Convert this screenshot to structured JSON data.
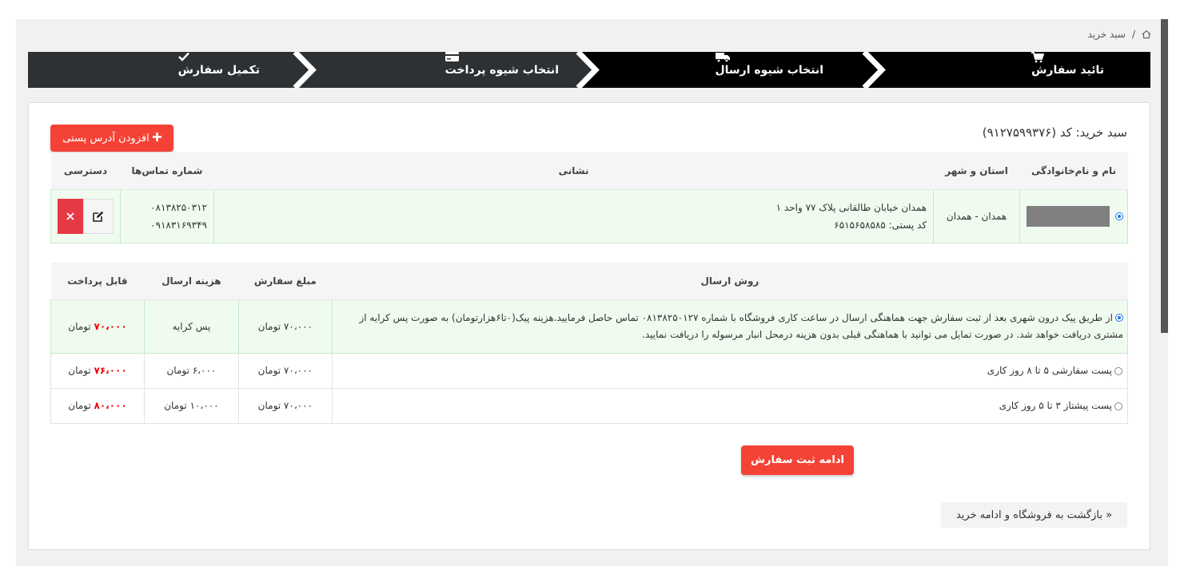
{
  "breadcrumb": {
    "home_icon": "home-icon",
    "separator": "/",
    "current": "سبد خرید"
  },
  "steps": [
    {
      "label": "تائید سفارش",
      "icon": "cart-icon"
    },
    {
      "label": "انتخاب شیوه ارسال",
      "icon": "truck-icon"
    },
    {
      "label": "انتخاب شیوه پرداخت",
      "icon": "credit-card-icon"
    },
    {
      "label": "تکمیل سفارش",
      "icon": "check-icon"
    }
  ],
  "cart": {
    "title": "سبد خرید: کد (۹۱۲۷۵۹۹۳۷۶)"
  },
  "add_address": {
    "label": "افزودن آدرس پستی"
  },
  "address_table": {
    "headers": [
      "نام و نام‌خانوادگی",
      "استان و شهر",
      "نشانی",
      "شماره تماس‌ها",
      "دسترسی"
    ],
    "row": {
      "province_city": "همدان - همدان",
      "address_line": "همدان خیابان طالقانی پلاک ۷۷ واحد ۱",
      "postal_code": "کد پستی: ۶۵۱۵۶۵۸۵۸۵",
      "phone1": "۰۸۱۳۸۲۵۰۳۱۲",
      "phone2": "۰۹۱۸۳۱۶۹۳۴۹"
    }
  },
  "shipping_table": {
    "headers": [
      "روش ارسال",
      "مبلغ سفارش",
      "هزینه ارسال",
      "قابل پرداخت"
    ],
    "rows": [
      {
        "method": "از طریق پیک درون شهری بعد از ثبت سفارش جهت هماهنگی ارسال در ساعت کاری فروشگاه با شماره ۰۸۱۳۸۲۵۰۱۲۷ تماس حاصل فرمایید.هزینه پیک(۰تا۶هزارتومان) به صورت پس کرایه از مشتری دریافت خواهد شد. در صورت تمایل می توانید با هماهنگی قبلی بدون هزینه درمحل انبار مرسوله را دریافت نمایید.",
        "order_amount": "۷۰،۰۰۰ تومان",
        "shipping_cost": "پس کرایه",
        "payable_value": "۷۰،۰۰۰",
        "payable_unit": "تومان"
      },
      {
        "method": "پست سفارشی ۵ تا ۸ روز کاری",
        "order_amount": "۷۰،۰۰۰ تومان",
        "shipping_cost": "۶،۰۰۰ تومان",
        "payable_value": "۷۶،۰۰۰",
        "payable_unit": "تومان"
      },
      {
        "method": "پست پیشتاز ۳ تا ۵ روز کاری",
        "order_amount": "۷۰،۰۰۰ تومان",
        "shipping_cost": "۱۰،۰۰۰ تومان",
        "payable_value": "۸۰،۰۰۰",
        "payable_unit": "تومان"
      }
    ]
  },
  "continue_button": {
    "label": "ادامه ثبت سفارش"
  },
  "back_link": {
    "label": "« بازگشت به فروشگاه و ادامه خرید"
  },
  "colors": {
    "accent": "#f44336",
    "danger": "#e53945",
    "price": "#e00000",
    "step_active": "#000000",
    "step_inactive": "#2e3133",
    "selected_row": "#f0fbf0"
  }
}
